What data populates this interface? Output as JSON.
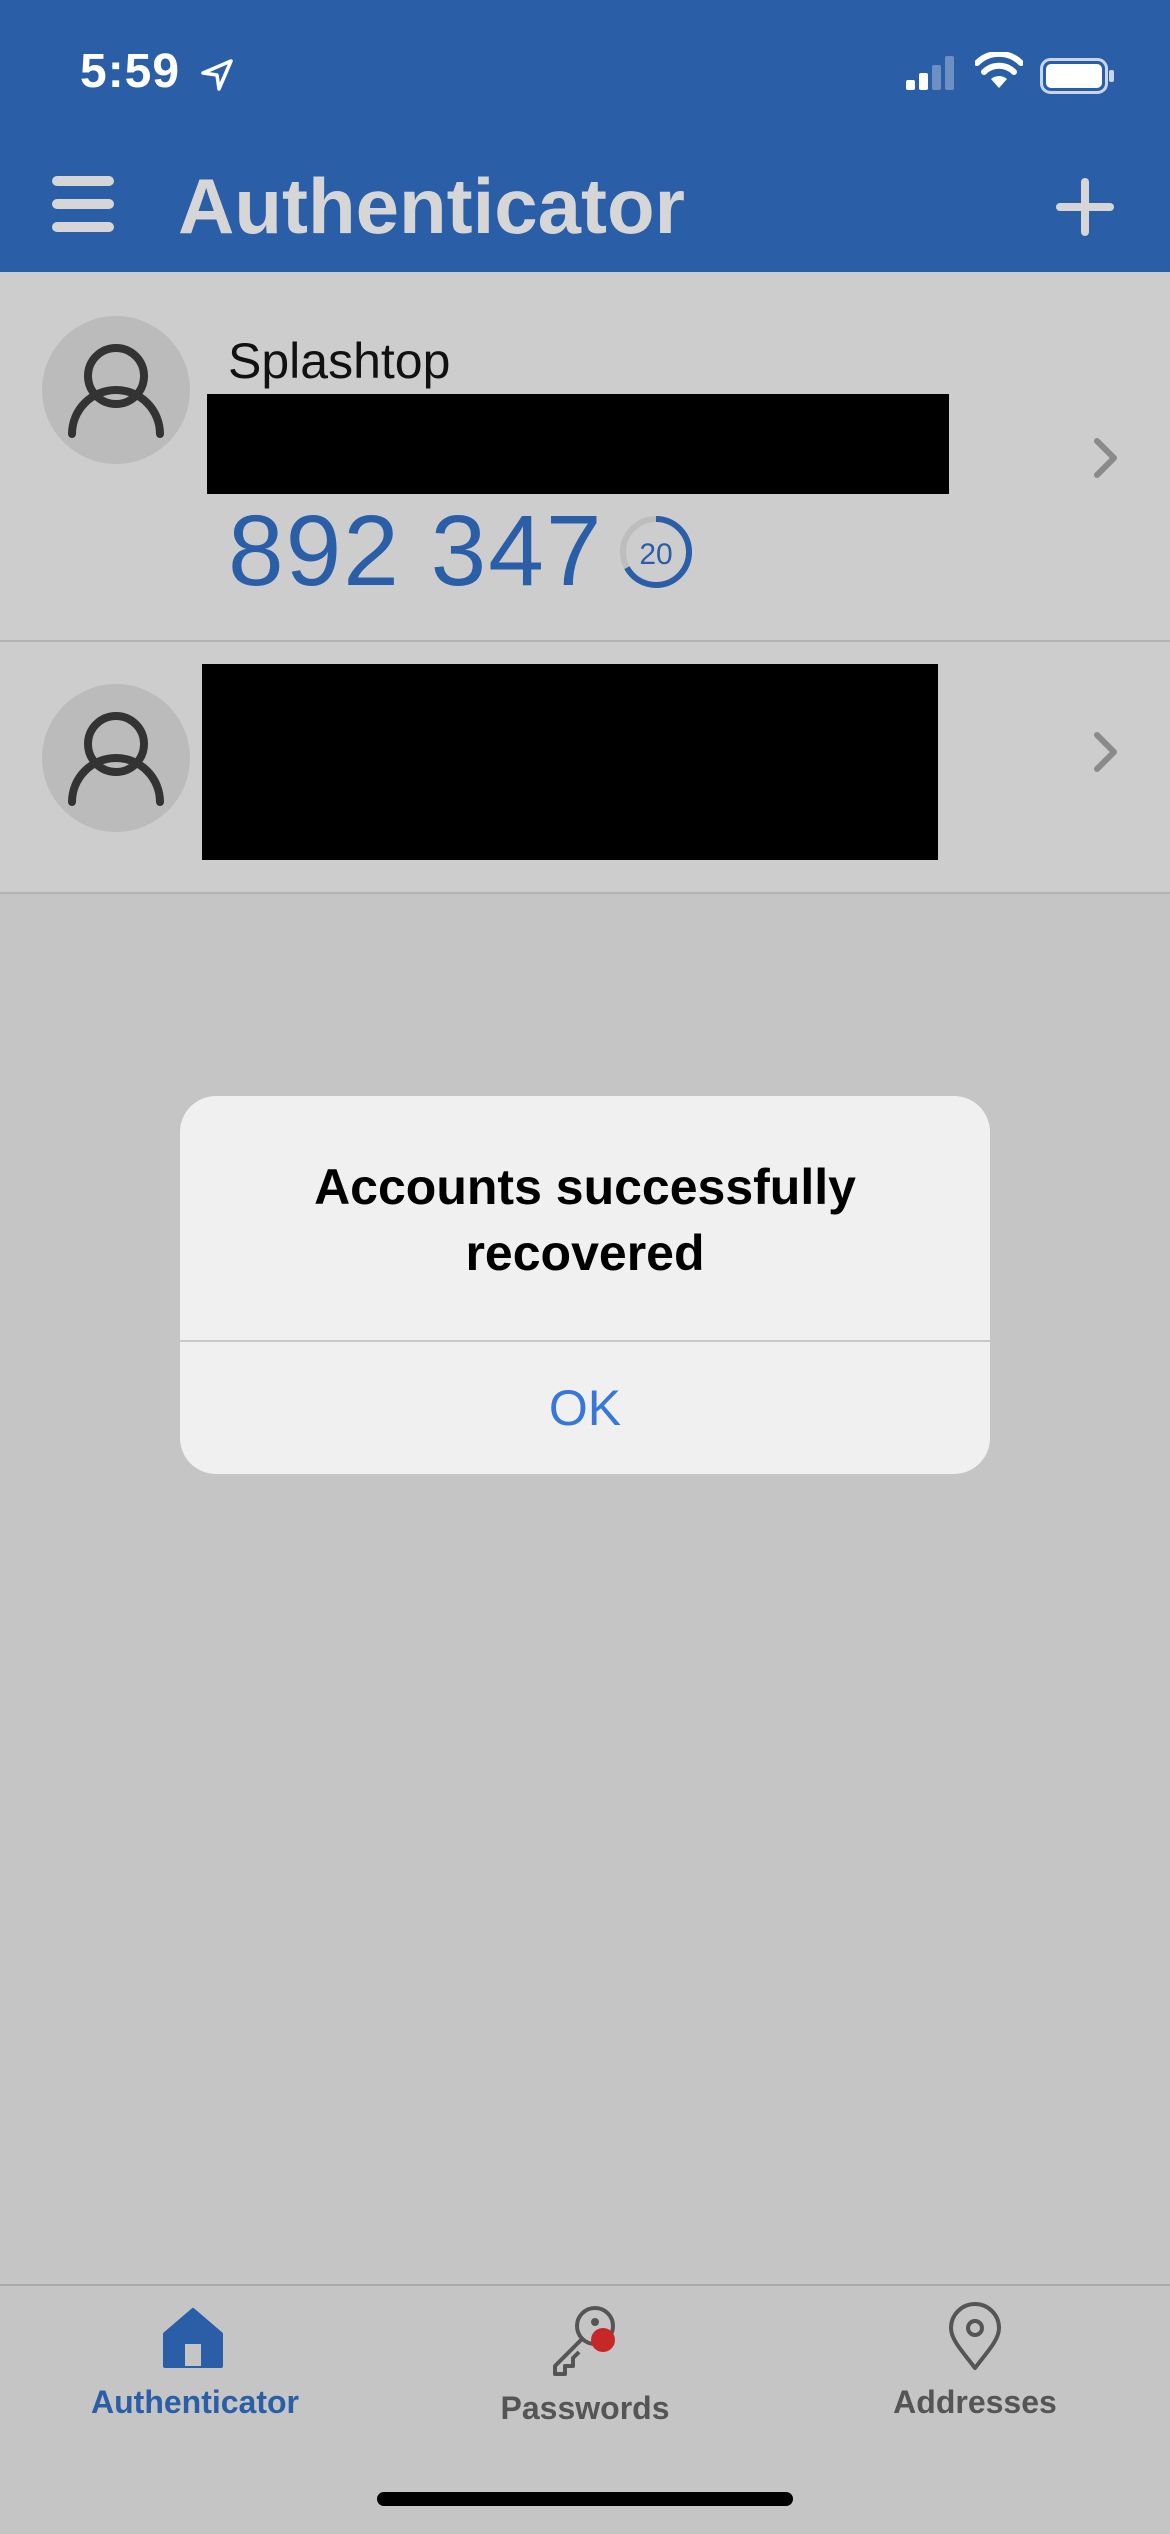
{
  "status_bar": {
    "time": "5:59"
  },
  "header": {
    "title": "Authenticator"
  },
  "accounts": [
    {
      "name": "Splashtop",
      "code": "892 347",
      "seconds_remaining": "20",
      "timer_fraction": 0.67
    },
    {
      "name": ""
    }
  ],
  "dialog": {
    "title_line1": "Accounts successfully",
    "title_line2": "recovered",
    "ok_label": "OK"
  },
  "tabs": [
    {
      "label": "Authenticator",
      "active": true
    },
    {
      "label": "Passwords",
      "active": false
    },
    {
      "label": "Addresses",
      "active": false
    }
  ],
  "colors": {
    "primary": "#2a5ea7",
    "link": "#3777d8",
    "badge": "#c62828"
  }
}
